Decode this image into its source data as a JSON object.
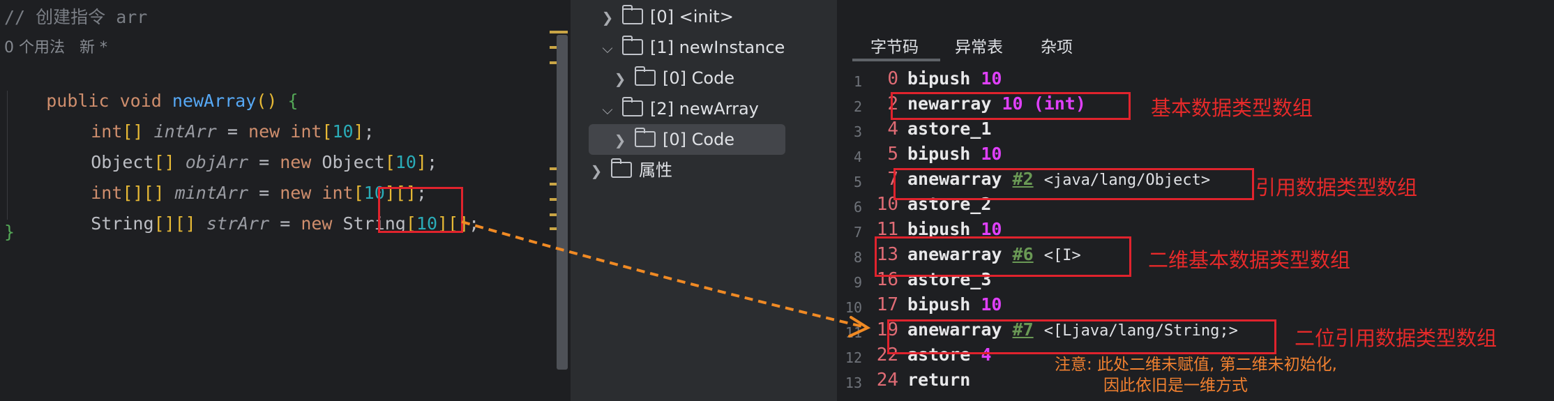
{
  "editor": {
    "comment": "// 创建指令 arr",
    "usage_hint": "0 个用法   新 *",
    "method_signature": {
      "kw_public": "public",
      "kw_void": "void",
      "name": "newArray",
      "parens": "()",
      "brace_open": "{"
    },
    "lines": [
      {
        "type": "int",
        "dims": "[]",
        "var": "intArr",
        "eq": "=",
        "kw_new": "new",
        "new_type": "int",
        "open": "[",
        "size": "10",
        "close": "]",
        "rest": ";"
      },
      {
        "type": "Object",
        "dims": "[]",
        "var": "objArr",
        "eq": "=",
        "kw_new": "new",
        "new_type": "Object",
        "open": "[",
        "size": "10",
        "close": "]",
        "rest": ";"
      },
      {
        "type": "int",
        "dims": "[][]",
        "var": "mintArr",
        "eq": "=",
        "kw_new": "new",
        "new_type": "int",
        "open": "[",
        "size": "10",
        "close": "][]",
        "rest": ";"
      },
      {
        "type": "String",
        "dims": "[][]",
        "var": "strArr",
        "eq": "=",
        "kw_new": "new",
        "new_type": "String",
        "open": "[",
        "size": "10",
        "close": "][]",
        "rest": ";"
      }
    ],
    "brace_close": "}"
  },
  "tree": {
    "items": [
      {
        "label": "[0] <init>",
        "expanded": false
      },
      {
        "label": "[1] newInstance",
        "expanded": true
      },
      {
        "label": "[0] Code",
        "expanded": false
      },
      {
        "label": "[2] newArray",
        "expanded": true
      },
      {
        "label": "[0] Code",
        "expanded": false,
        "selected": true
      },
      {
        "label": "属性",
        "expanded": false
      }
    ]
  },
  "tabs": [
    "字节码",
    "异常表",
    "杂项"
  ],
  "bytecode": [
    {
      "line": "1",
      "offset": "0",
      "op": "bipush",
      "arg": "10",
      "argtype": "num"
    },
    {
      "line": "2",
      "offset": "2",
      "op": "newarray",
      "arg": "10 (int)",
      "argtype": "num"
    },
    {
      "line": "3",
      "offset": "4",
      "op": "astore_1",
      "arg": "",
      "argtype": ""
    },
    {
      "line": "4",
      "offset": "5",
      "op": "bipush",
      "arg": "10",
      "argtype": "num"
    },
    {
      "line": "5",
      "offset": "7",
      "op": "anewarray",
      "ref": "#2",
      "arg": "<java/lang/Object>",
      "argtype": "ref"
    },
    {
      "line": "6",
      "offset": "10",
      "op": "astore_2",
      "arg": "",
      "argtype": ""
    },
    {
      "line": "7",
      "offset": "11",
      "op": "bipush",
      "arg": "10",
      "argtype": "num"
    },
    {
      "line": "8",
      "offset": "13",
      "op": "anewarray",
      "ref": "#6",
      "arg": "<[I>",
      "argtype": "ref"
    },
    {
      "line": "9",
      "offset": "16",
      "op": "astore_3",
      "arg": "",
      "argtype": ""
    },
    {
      "line": "10",
      "offset": "17",
      "op": "bipush",
      "arg": "10",
      "argtype": "num"
    },
    {
      "line": "11",
      "offset": "19",
      "op": "anewarray",
      "ref": "#7",
      "arg": "<[Ljava/lang/String;>",
      "argtype": "ref"
    },
    {
      "line": "12",
      "offset": "22",
      "op": "astore",
      "arg": "4",
      "argtype": "num"
    },
    {
      "line": "13",
      "offset": "24",
      "op": "return",
      "arg": "",
      "argtype": ""
    }
  ],
  "annotations": {
    "primitive_array": "基本数据类型数组",
    "reference_array": "引用数据类型数组",
    "primitive_2d_array": "二维基本数据类型数组",
    "reference_2d_array": "二位引用数据类型数组",
    "note_line1": "注意: 此处二维未赋值, 第二维未初始化,",
    "note_line2": "因此依旧是一维方式"
  },
  "colors": {
    "annotation_red": "#e0232d",
    "note_orange": "#f08030",
    "arrow_orange": "#f08a24",
    "keyword": "#cf8e6d",
    "number": "#2aacb8",
    "bytecode_number": "#e040fb",
    "offset": "#e06c75"
  }
}
